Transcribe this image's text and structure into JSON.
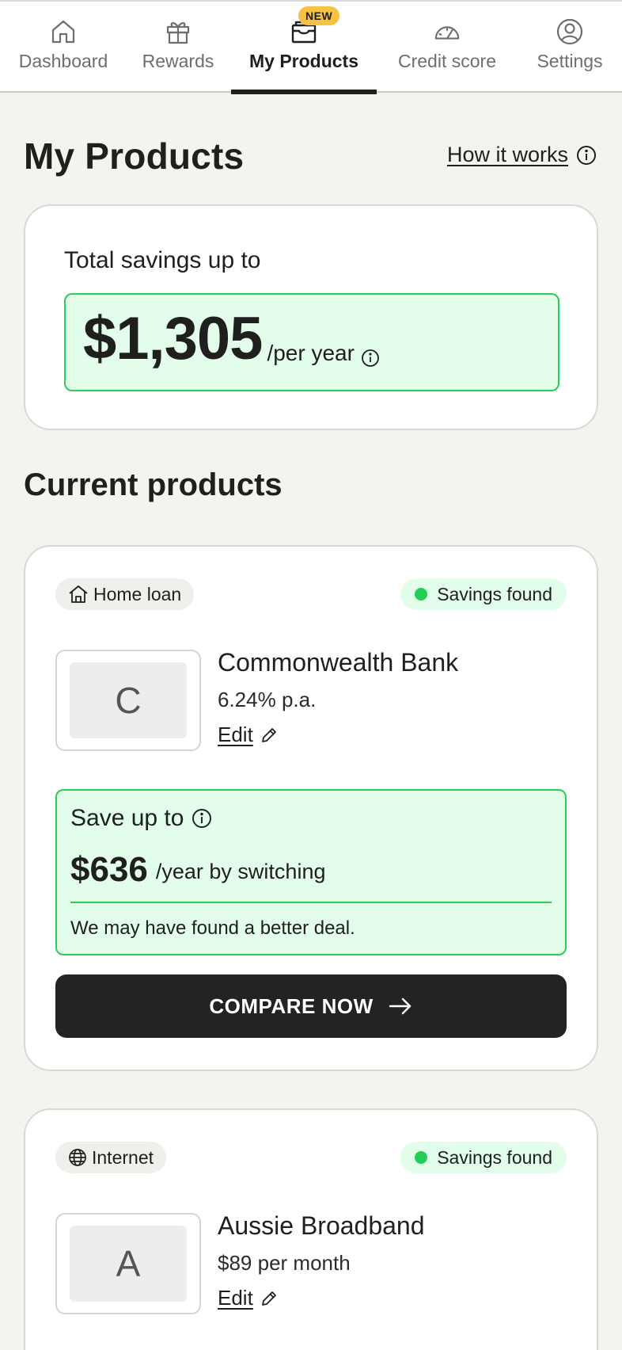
{
  "nav": {
    "tabs": [
      {
        "label": "Dashboard",
        "icon": "home-icon"
      },
      {
        "label": "Rewards",
        "icon": "gift-icon"
      },
      {
        "label": "My Products",
        "icon": "wallet-icon",
        "active": true,
        "badge": "NEW"
      },
      {
        "label": "Credit score",
        "icon": "gauge-icon"
      },
      {
        "label": "Settings",
        "icon": "user-circle-icon"
      }
    ]
  },
  "header": {
    "title": "My Products",
    "how_it_works": "How it works"
  },
  "summary": {
    "label": "Total savings up to",
    "amount": "$1,305",
    "period": "/per year"
  },
  "section": {
    "title": "Current products"
  },
  "products": [
    {
      "category": "Home loan",
      "category_icon": "house-icon",
      "status": "Savings found",
      "logo_letter": "C",
      "provider": "Commonwealth Bank",
      "detail": "6.24% p.a.",
      "edit": "Edit",
      "save_label": "Save up to",
      "save_amount": "$636",
      "save_suffix": "/year by switching",
      "save_note": "We may have found a better deal.",
      "cta": "COMPARE NOW"
    },
    {
      "category": "Internet",
      "category_icon": "globe-icon",
      "status": "Savings found",
      "logo_letter": "A",
      "provider": "Aussie Broadband",
      "detail": "$89 per month",
      "edit": "Edit"
    }
  ],
  "colors": {
    "accent_green": "#2ecc55",
    "green_bg": "#e2fde9",
    "badge_yellow": "#f6c244",
    "dark": "#232321",
    "page_bg": "#f4f3ef"
  }
}
